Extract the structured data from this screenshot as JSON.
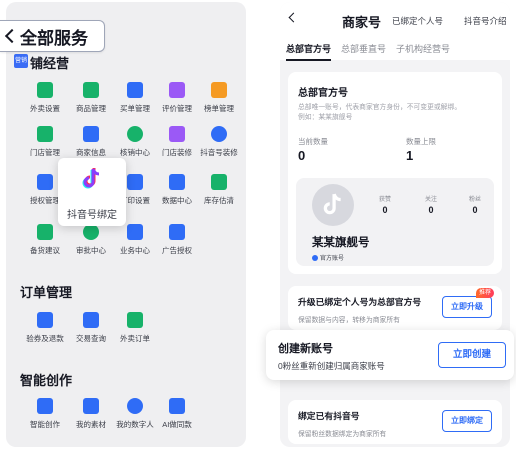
{
  "left": {
    "title": "全部服务",
    "corner_label": "营销",
    "section1_partial": "铺经营",
    "section1_items_row1": [
      "外卖设置",
      "商品管理",
      "买单管理",
      "评价管理",
      "榜单管理"
    ],
    "section1_items_row2": [
      "门店管理",
      "商家信息",
      "核销中心",
      "门店装修",
      "抖音号装修"
    ],
    "section1_items_row3": [
      "授权管理",
      "",
      "打印设置",
      "数据中心",
      "库存估清"
    ],
    "section1_items_row4": [
      "备货建议",
      "审批中心",
      "业务中心",
      "广告授权"
    ],
    "tooltip_label": "抖音号绑定",
    "section2_title": "订单管理",
    "section2_items": [
      "验券及退款",
      "交易查询",
      "外卖订单"
    ],
    "section3_title": "智能创作",
    "section3_items": [
      "智能创作",
      "我的素材",
      "我的数字人",
      "AI做同款"
    ]
  },
  "right": {
    "title": "商家号",
    "bound_link": "已绑定个人号",
    "intro_link": "抖音号介绍",
    "tabs": [
      "总部官方号",
      "总部垂直号",
      "子机构经营号"
    ],
    "card": {
      "title": "总部官方号",
      "desc_line1": "总部唯一账号，代表商家官方身份，不可变更或解绑。",
      "desc_line2": "例如：某某旗舰号",
      "current_label": "当前数量",
      "current_value": "0",
      "limit_label": "数量上限",
      "limit_value": "1",
      "stats_labels": [
        "获赞",
        "关注",
        "粉丝"
      ],
      "stats_values": [
        "0",
        "0",
        "0"
      ],
      "account_name": "某某旗舰号",
      "account_badge": "官方账号"
    },
    "upgrade": {
      "title": "升级已绑定个人号为总部官方号",
      "desc": "保留数据与内容，转移为商家所有",
      "button": "立即升级",
      "hot": "推荐"
    },
    "bind": {
      "title": "绑定已有抖音号",
      "desc": "保留粉丝数据绑定为商家所有",
      "button": "立即绑定"
    }
  },
  "create": {
    "title": "创建新账号",
    "desc": "0粉丝重新创建归属商家账号",
    "button": "立即创建"
  },
  "colors": {
    "accent": "#2f6cf6",
    "icon_green": "#17b26a",
    "icon_blue": "#2f6cf6",
    "icon_purple": "#9b59f6",
    "icon_orange": "#f59a23"
  }
}
